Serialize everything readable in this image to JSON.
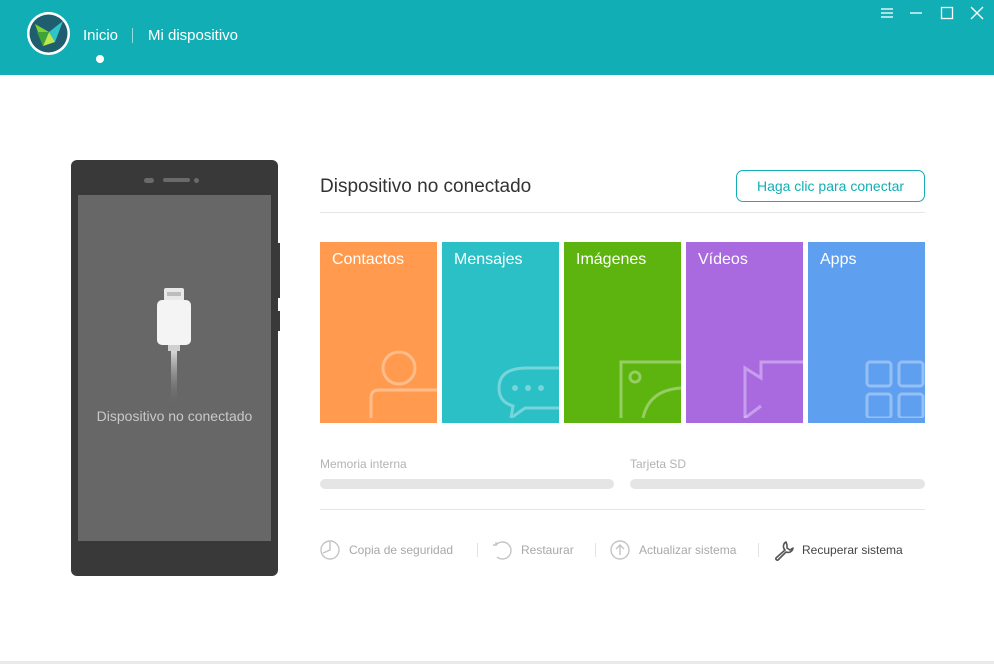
{
  "header": {
    "bg_color": "#11afb5",
    "logo_icon": "app-logo-icon",
    "nav": [
      {
        "label": "Inicio",
        "active": true
      },
      {
        "label": "Mi dispositivo",
        "active": false
      }
    ],
    "window_controls": [
      "menu-icon",
      "minimize-icon",
      "maximize-icon",
      "close-icon"
    ]
  },
  "phone": {
    "screen_text": "Dispositivo no conectado",
    "icon": "usb-cable-icon"
  },
  "main": {
    "status_title": "Dispositivo no conectado",
    "connect_button": "Haga clic para conectar",
    "tiles": [
      {
        "label": "Contactos",
        "color": "#ff9a4f",
        "icon": "person-icon"
      },
      {
        "label": "Mensajes",
        "color": "#2bbfc6",
        "icon": "chat-bubble-icon"
      },
      {
        "label": "Imágenes",
        "color": "#5db40f",
        "icon": "image-icon"
      },
      {
        "label": "Vídeos",
        "color": "#a96ae0",
        "icon": "video-icon"
      },
      {
        "label": "Apps",
        "color": "#5e9ff0",
        "icon": "apps-grid-icon"
      }
    ],
    "storage": [
      {
        "label": "Memoria interna"
      },
      {
        "label": "Tarjeta SD"
      }
    ],
    "actions": [
      {
        "label": "Copia de seguridad",
        "icon": "backup-icon",
        "enabled": false
      },
      {
        "label": "Restaurar",
        "icon": "restore-icon",
        "enabled": false
      },
      {
        "label": "Actualizar sistema",
        "icon": "update-icon",
        "enabled": false
      },
      {
        "label": "Recuperar sistema",
        "icon": "wrench-icon",
        "enabled": true
      }
    ]
  }
}
